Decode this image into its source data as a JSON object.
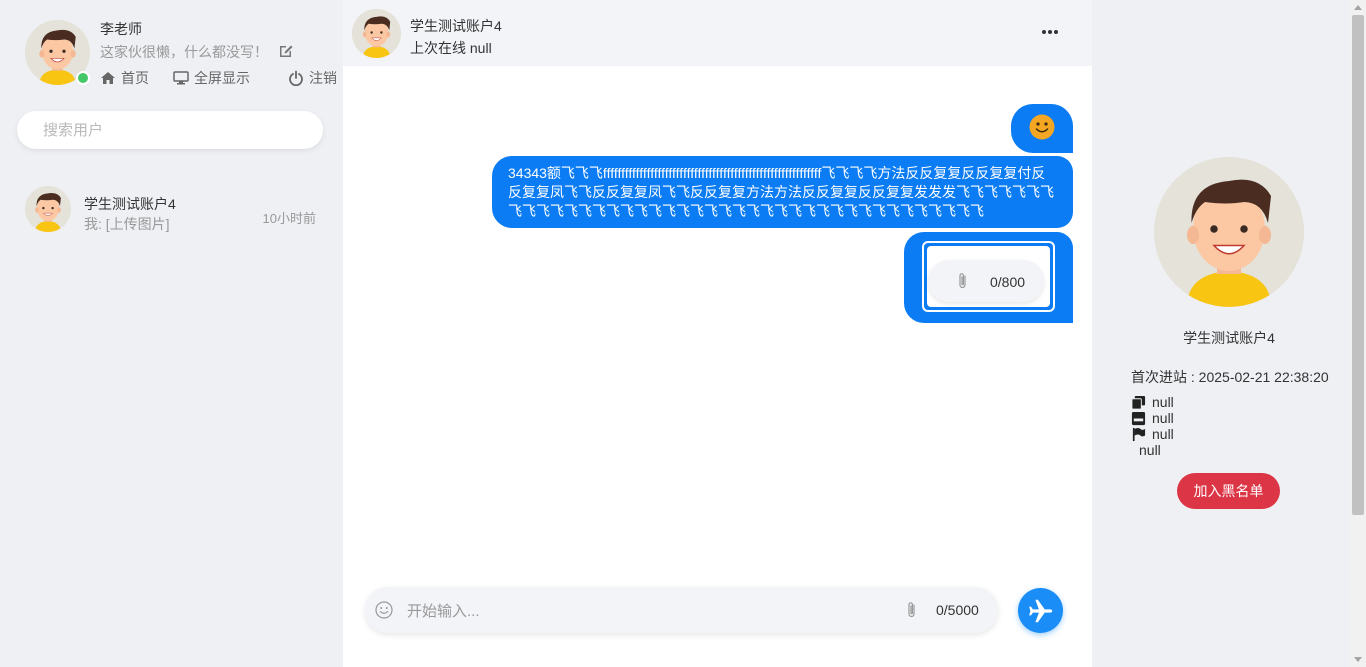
{
  "me": {
    "name": "李老师",
    "signature": "这家伙很懒，什么都没写！",
    "avatar_icon": "cartoon-boy-avatar"
  },
  "nav": {
    "home": "首页",
    "fullscreen": "全屏显示",
    "logout": "注销"
  },
  "search": {
    "placeholder": "搜索用户"
  },
  "contacts": [
    {
      "name": "学生测试账户4",
      "last_message": "我: [上传图片]",
      "time": "10小时前"
    }
  ],
  "chat": {
    "peer_name": "学生测试账户4",
    "peer_status": "上次在线 null",
    "messages": [
      {
        "type": "emoji",
        "icon": "smiley-face-icon"
      },
      {
        "type": "text",
        "text": "34343额飞飞飞ffffffffffffffffffffffffffffffffffffffffffffffffffffffffffff飞飞飞飞方法反反复复反反复复付反反复复凤飞飞反反复复凤飞飞反反复复方法方法反反复复反反复复发发发飞飞飞飞飞飞飞飞飞飞飞飞飞飞飞飞飞飞飞飞飞飞飞飞飞飞飞飞飞飞飞飞飞飞飞飞飞飞飞飞飞"
      },
      {
        "type": "file",
        "counter": "0/800"
      }
    ],
    "composer_placeholder": "开始输入...",
    "composer_counter": "0/5000"
  },
  "profile": {
    "name": "学生测试账户4",
    "first_visit": "首次进站 : 2025-02-21 22:38:20",
    "info_1": "null",
    "info_2": "null",
    "info_3": "null",
    "info_4": "null",
    "blacklist_button": "加入黑名单"
  },
  "colors": {
    "bubble": "#0b7cf3",
    "send": "#1a8df6",
    "danger": "#dc3545",
    "online": "#44c767"
  }
}
